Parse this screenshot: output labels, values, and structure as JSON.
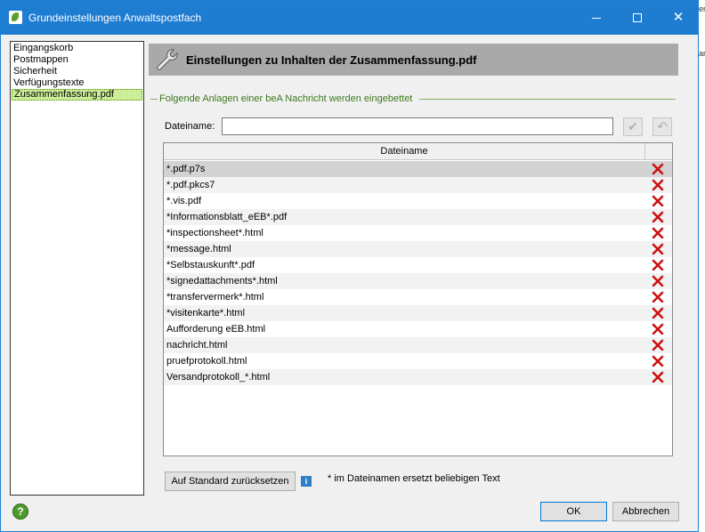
{
  "window": {
    "title": "Grundeinstellungen Anwaltspostfach"
  },
  "background_peek": [
    "er",
    "ar"
  ],
  "nav": {
    "items": [
      {
        "label": "Eingangskorb"
      },
      {
        "label": "Postmappen"
      },
      {
        "label": "Sicherheit"
      },
      {
        "label": "Verfügungstexte"
      },
      {
        "label": "Zusammenfassung.pdf",
        "selected": true
      }
    ]
  },
  "header": {
    "title": "Einstellungen zu Inhalten der Zusammenfassung.pdf"
  },
  "group": {
    "label": "Folgende Anlagen einer beA Nachricht werden eingebettet"
  },
  "filename_field": {
    "label": "Dateiname:",
    "value": ""
  },
  "grid": {
    "column_header": "Dateiname",
    "rows": [
      "*.pdf.p7s",
      "*.pdf.pkcs7",
      "*.vis.pdf",
      "*Informationsblatt_eEB*.pdf",
      "*inspectionsheet*.html",
      "*message.html",
      "*Selbstauskunft*.pdf",
      "*signedattachments*.html",
      "*transfervermerk*.html",
      "*visitenkarte*.html",
      "Aufforderung eEB.html",
      "nachricht.html",
      "pruefprotokoll.html",
      "Versandprotokoll_*.html"
    ],
    "selected_row": 0
  },
  "footer": {
    "reset_button": "Auf Standard zurücksetzen",
    "note": "* im Dateinamen ersetzt beliebigen Text",
    "ok_button": "OK",
    "cancel_button": "Abbrechen"
  },
  "colors": {
    "titlebar": "#1e7cd1",
    "header": "#a9a9a9",
    "group_label": "#3c7a1e",
    "nav_selected": "#ccee99",
    "delete_icon": "#cc1111"
  },
  "icons": {
    "app": "app-leaf-icon",
    "wrench": "wrench-icon",
    "confirm": "checkmark-icon",
    "undo": "undo-icon",
    "delete": "delete-x-icon",
    "info": "info-icon",
    "help": "help-icon"
  }
}
